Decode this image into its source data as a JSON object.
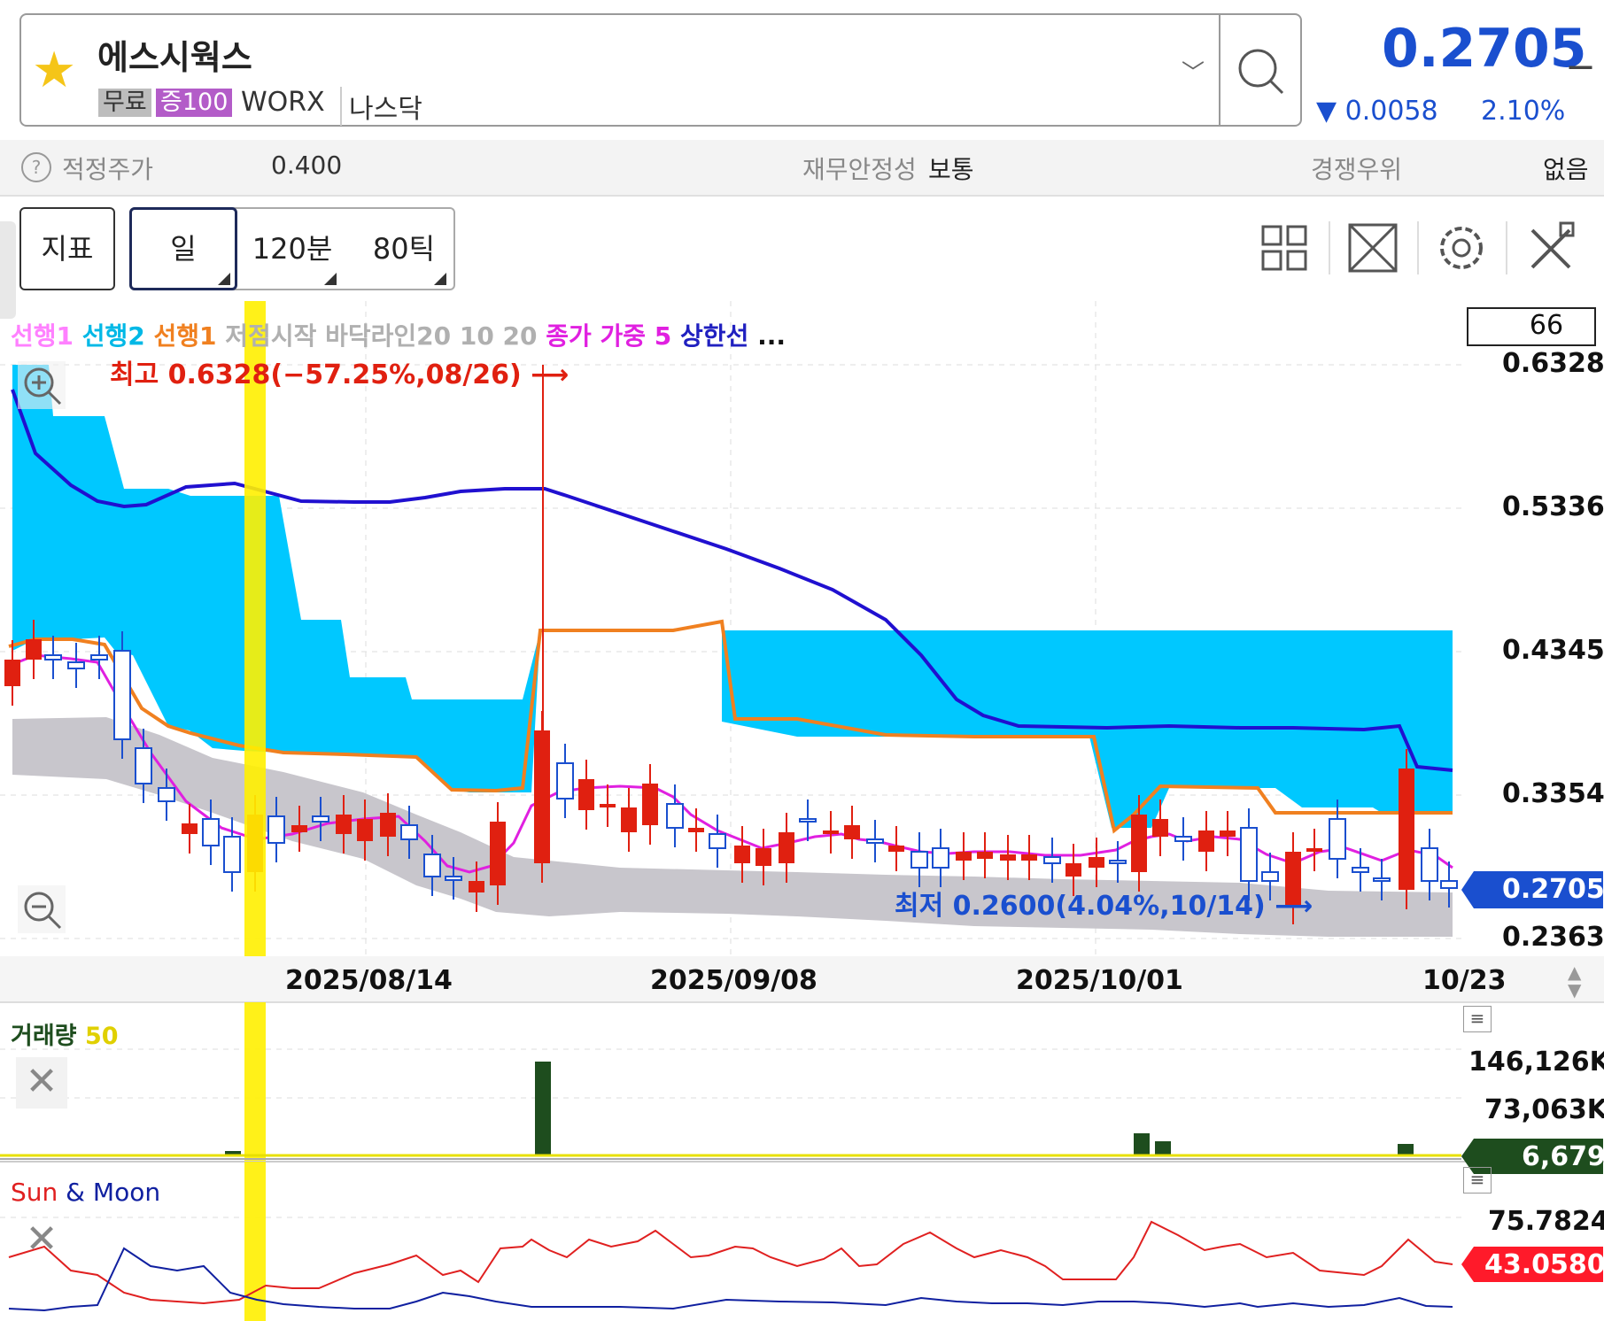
{
  "header": {
    "stock_name": "에스시웍스",
    "badge_free": "무료",
    "badge_margin": "증100",
    "ticker": "WORX",
    "market": "나스닥",
    "price": "0.2705",
    "price_suffix": "_",
    "change": "▼ 0.0058",
    "change_pct": "2.10%",
    "change_color": "#1a4fcf"
  },
  "info": {
    "fair_price_label": "적정주가",
    "fair_price_value": "0.400",
    "financial_stability_label": "재무안정성",
    "financial_stability_value": "보통",
    "competitive_edge_label": "경쟁우위",
    "competitive_edge_value": "없음"
  },
  "toolbar": {
    "indicator_label": "지표",
    "periods": [
      "일",
      "120분",
      "80틱"
    ],
    "icons": [
      "layout-grid-icon",
      "fullscreen-icon",
      "gear-icon",
      "tools-icon"
    ]
  },
  "chart": {
    "legend": [
      {
        "text": "선행1",
        "color": "#ff80ff"
      },
      {
        "text": "선행2",
        "color": "#00b8e6"
      },
      {
        "text": "선행1",
        "color": "#f08020"
      },
      {
        "text": "저점시작 바닥라인20 10 20",
        "color": "#b0b0b0"
      },
      {
        "text": "종가 가중 5",
        "color": "#e020e0"
      },
      {
        "text": "상한선",
        "color": "#2020c0"
      },
      {
        "text": "...",
        "color": "#111111"
      }
    ],
    "period_count": "66",
    "y_ticks": [
      "0.6328",
      "0.5336",
      "0.4345",
      "0.3354",
      "0.2363"
    ],
    "current_price_tag": "0.2705",
    "high_annotation": "최고 0.6328(−57.25%,08/26)",
    "low_annotation": "최저 0.2600(4.04%,10/14)",
    "x_dates": [
      "2025/08/14",
      "2025/09/08",
      "2025/10/01",
      "10/23"
    ]
  },
  "volume": {
    "title": "거래량",
    "period": "50",
    "ticks": [
      "146,126K",
      "73,063K"
    ],
    "current_tag": "6,679"
  },
  "sunmoon": {
    "title_sun": "Sun",
    "title_amp": "&",
    "title_moon": "Moon",
    "tick": "75.7824",
    "current_tag": "43.0580"
  }
}
